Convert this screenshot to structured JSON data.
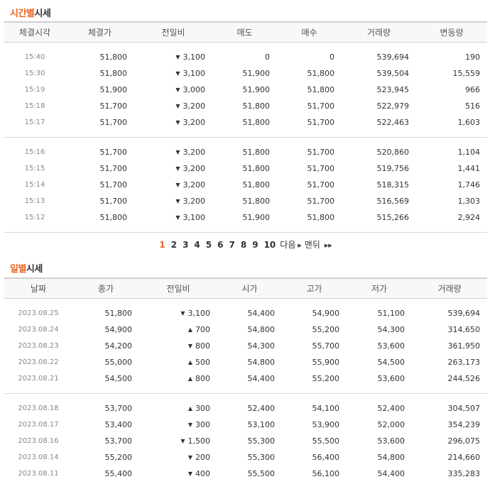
{
  "time_section": {
    "title_highlight": "시간별",
    "title_rest": "시세",
    "headers": [
      "체결시각",
      "체결가",
      "전일비",
      "매도",
      "매수",
      "거래량",
      "변동량"
    ],
    "groups": [
      [
        {
          "time": "15:40",
          "price": "51,800",
          "dir": "down",
          "change": "3,100",
          "sell": "0",
          "buy": "0",
          "volume": "539,694",
          "delta": "190"
        },
        {
          "time": "15:30",
          "price": "51,800",
          "dir": "down",
          "change": "3,100",
          "sell": "51,900",
          "buy": "51,800",
          "volume": "539,504",
          "delta": "15,559"
        },
        {
          "time": "15:19",
          "price": "51,900",
          "dir": "down",
          "change": "3,000",
          "sell": "51,900",
          "buy": "51,800",
          "volume": "523,945",
          "delta": "966"
        },
        {
          "time": "15:18",
          "price": "51,700",
          "dir": "down",
          "change": "3,200",
          "sell": "51,800",
          "buy": "51,700",
          "volume": "522,979",
          "delta": "516"
        },
        {
          "time": "15:17",
          "price": "51,700",
          "dir": "down",
          "change": "3,200",
          "sell": "51,800",
          "buy": "51,700",
          "volume": "522,463",
          "delta": "1,603"
        }
      ],
      [
        {
          "time": "15:16",
          "price": "51,700",
          "dir": "down",
          "change": "3,200",
          "sell": "51,800",
          "buy": "51,700",
          "volume": "520,860",
          "delta": "1,104"
        },
        {
          "time": "15:15",
          "price": "51,700",
          "dir": "down",
          "change": "3,200",
          "sell": "51,800",
          "buy": "51,700",
          "volume": "519,756",
          "delta": "1,441"
        },
        {
          "time": "15:14",
          "price": "51,700",
          "dir": "down",
          "change": "3,200",
          "sell": "51,800",
          "buy": "51,700",
          "volume": "518,315",
          "delta": "1,746"
        },
        {
          "time": "15:13",
          "price": "51,700",
          "dir": "down",
          "change": "3,200",
          "sell": "51,800",
          "buy": "51,700",
          "volume": "516,569",
          "delta": "1,303"
        },
        {
          "time": "15:12",
          "price": "51,800",
          "dir": "down",
          "change": "3,100",
          "sell": "51,900",
          "buy": "51,800",
          "volume": "515,266",
          "delta": "2,924"
        }
      ]
    ]
  },
  "pagination": {
    "pages": [
      "1",
      "2",
      "3",
      "4",
      "5",
      "6",
      "7",
      "8",
      "9",
      "10"
    ],
    "current": "1",
    "next_label": "다음",
    "last_label": "맨뒤"
  },
  "daily_section": {
    "title_highlight": "일별",
    "title_rest": "시세",
    "headers": [
      "날짜",
      "종가",
      "전일비",
      "시가",
      "고가",
      "저가",
      "거래량"
    ],
    "groups": [
      [
        {
          "date": "2023.08.25",
          "close": "51,800",
          "dir": "down",
          "change": "3,100",
          "open": "54,400",
          "high": "54,900",
          "low": "51,100",
          "volume": "539,694"
        },
        {
          "date": "2023.08.24",
          "close": "54,900",
          "dir": "up",
          "change": "700",
          "open": "54,800",
          "high": "55,200",
          "low": "54,300",
          "volume": "314,650"
        },
        {
          "date": "2023.08.23",
          "close": "54,200",
          "dir": "down",
          "change": "800",
          "open": "54,300",
          "high": "55,700",
          "low": "53,600",
          "volume": "361,950"
        },
        {
          "date": "2023.08.22",
          "close": "55,000",
          "dir": "up",
          "change": "500",
          "open": "54,800",
          "high": "55,900",
          "low": "54,500",
          "volume": "263,173"
        },
        {
          "date": "2023.08.21",
          "close": "54,500",
          "dir": "up",
          "change": "800",
          "open": "54,400",
          "high": "55,200",
          "low": "53,600",
          "volume": "244,526"
        }
      ],
      [
        {
          "date": "2023.08.18",
          "close": "53,700",
          "dir": "up",
          "change": "300",
          "open": "52,400",
          "high": "54,100",
          "low": "52,400",
          "volume": "304,507"
        },
        {
          "date": "2023.08.17",
          "close": "53,400",
          "dir": "down",
          "change": "300",
          "open": "53,100",
          "high": "53,900",
          "low": "52,000",
          "volume": "354,239"
        },
        {
          "date": "2023.08.16",
          "close": "53,700",
          "dir": "down",
          "change": "1,500",
          "open": "55,300",
          "high": "55,500",
          "low": "53,600",
          "volume": "296,075"
        },
        {
          "date": "2023.08.14",
          "close": "55,200",
          "dir": "down",
          "change": "200",
          "open": "55,300",
          "high": "56,400",
          "low": "54,800",
          "volume": "214,660"
        },
        {
          "date": "2023.08.11",
          "close": "55,400",
          "dir": "down",
          "change": "400",
          "open": "55,500",
          "high": "56,100",
          "low": "54,400",
          "volume": "335,283"
        }
      ]
    ]
  },
  "colors": {
    "accent": "#e8621f",
    "down": "#1f5bd0",
    "up": "#d60000"
  }
}
